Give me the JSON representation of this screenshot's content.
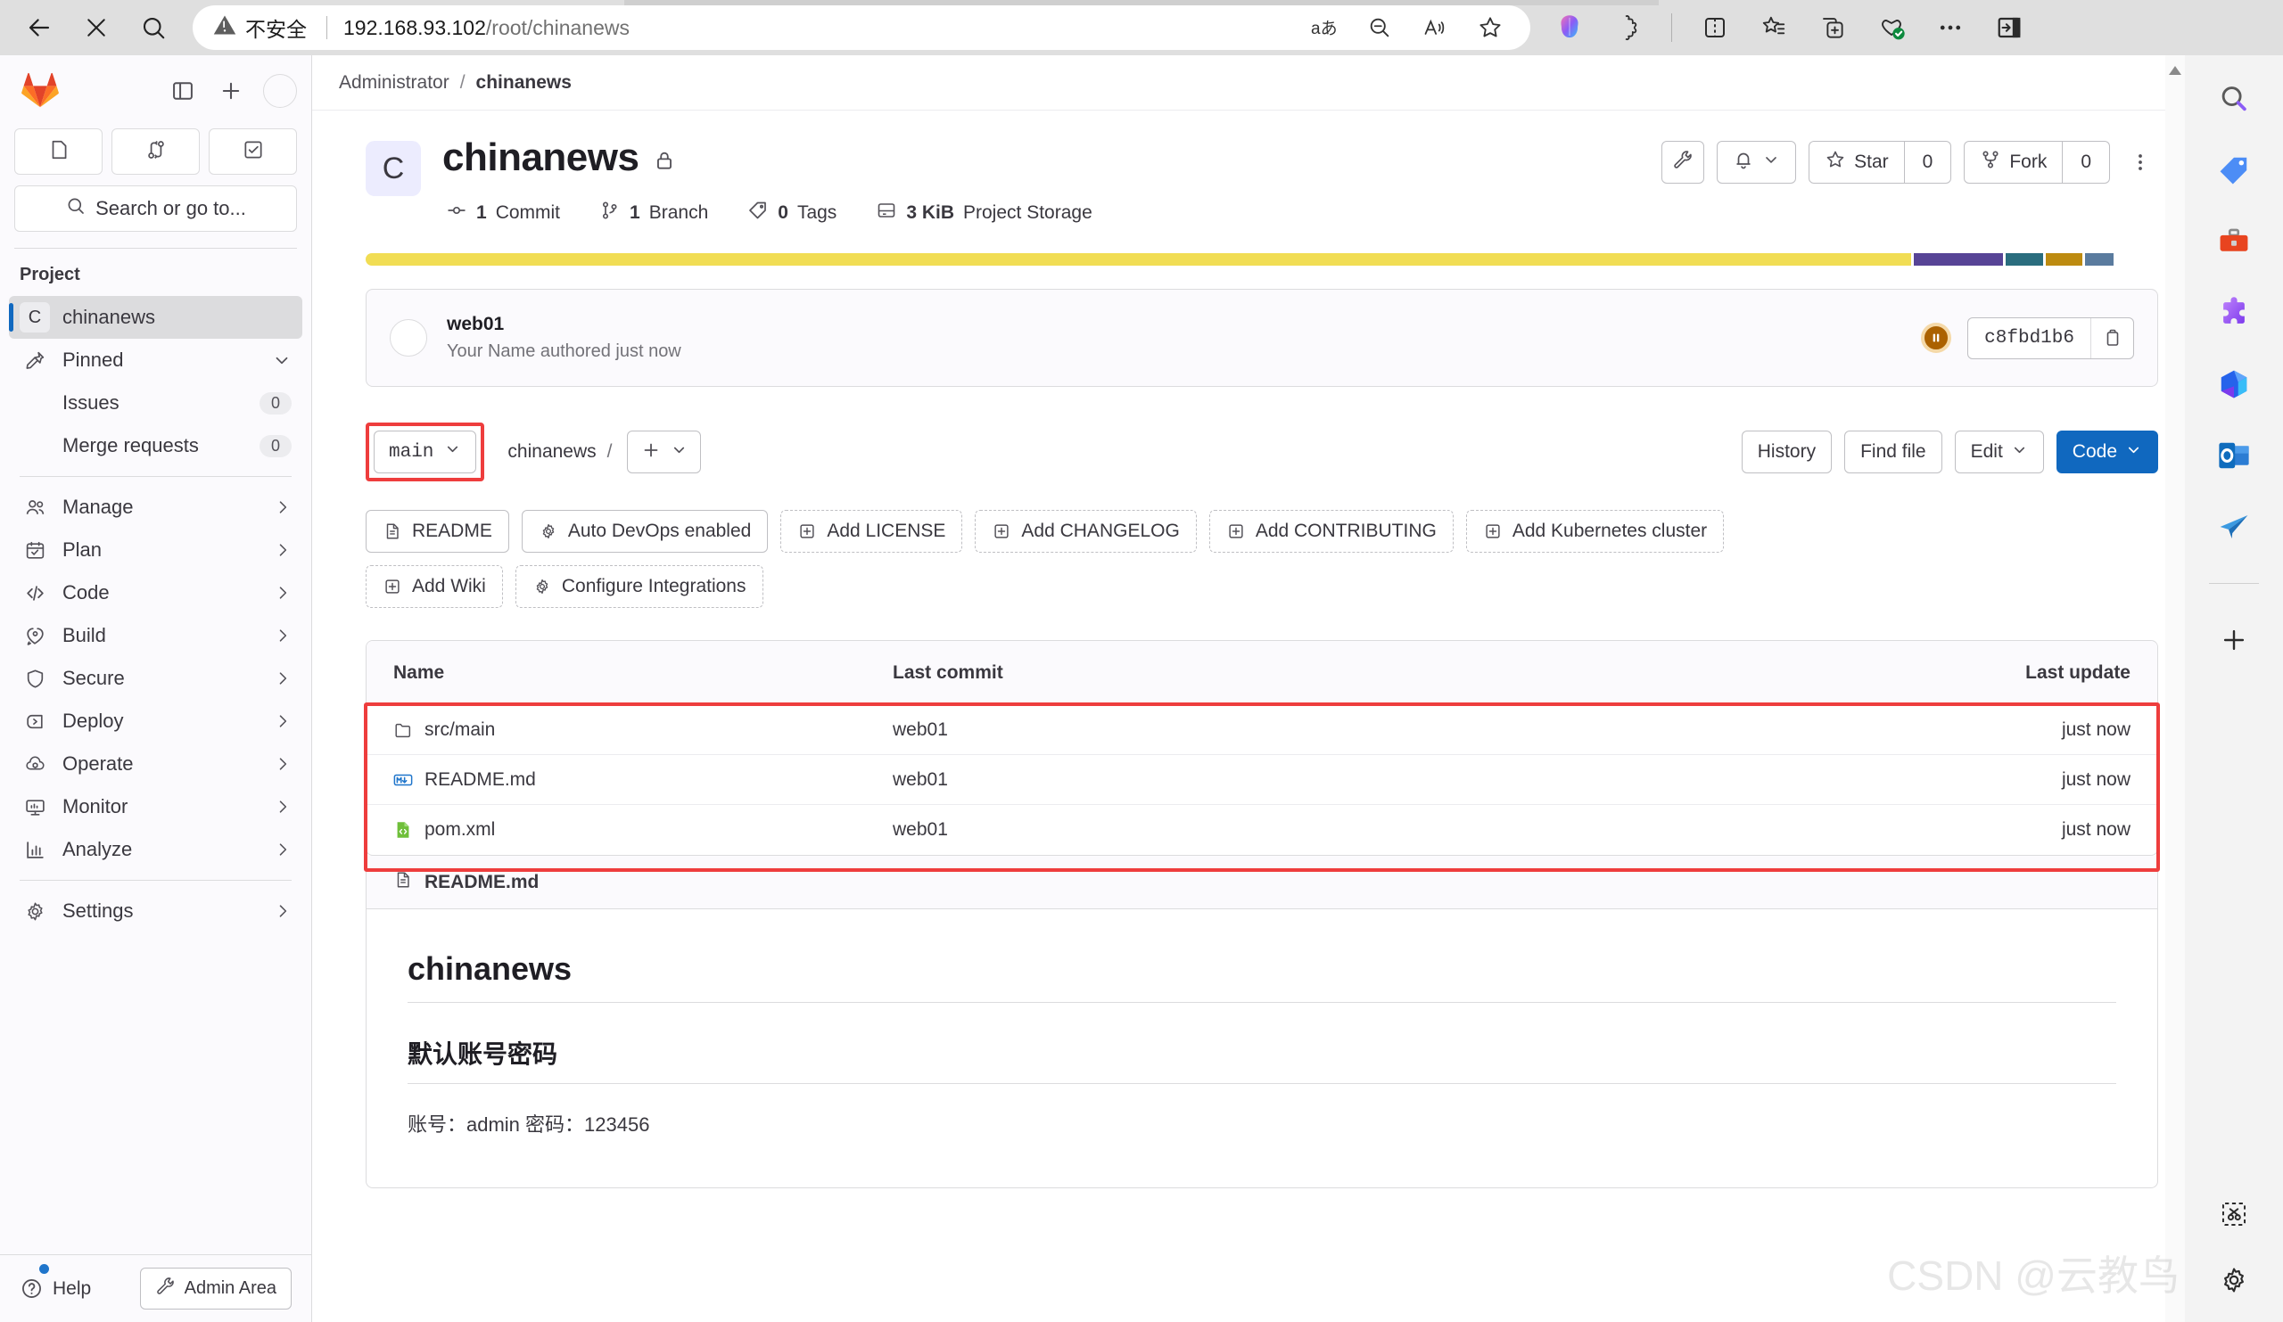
{
  "browser": {
    "security_label": "不安全",
    "url_host": "192.168.93.102",
    "url_path": "/root/chinanews",
    "back_icon": "back-arrow-icon",
    "stop_icon": "stop-x-icon",
    "search_icon": "search-icon",
    "warning_icon": "warning-triangle-icon",
    "url_icons": [
      "translate-icon",
      "zoom-out-icon",
      "read-aloud-icon",
      "favorite-star-icon"
    ],
    "toolbar_icons": [
      "copilot-icon",
      "extensions-icon",
      "split-screen-icon",
      "collections-icon",
      "add-tab-group-icon",
      "browser-essentials-icon",
      "more-options-icon",
      "sidebar-toggle-icon"
    ]
  },
  "sidebar": {
    "logo_icon": "gitlab-logo-icon",
    "toggle_icon": "sidebar-panel-icon",
    "new_icon": "plus-icon",
    "avatar_icon": "user-avatar",
    "quick_buttons": [
      {
        "name": "issues-shortcut",
        "icon": "issue-icon"
      },
      {
        "name": "merge-requests-shortcut",
        "icon": "merge-request-icon"
      },
      {
        "name": "todos-shortcut",
        "icon": "todo-check-icon"
      }
    ],
    "search_placeholder": "Search or go to...",
    "search_icon": "search-icon",
    "section_label": "Project",
    "project": {
      "initial": "C",
      "label": "chinanews"
    },
    "pinned": {
      "label": "Pinned",
      "icon": "pin-icon",
      "chevron": "chevron-down-icon"
    },
    "pinned_items": [
      {
        "label": "Issues",
        "badge": "0"
      },
      {
        "label": "Merge requests",
        "badge": "0"
      }
    ],
    "nav_items": [
      {
        "label": "Manage",
        "icon": "users-icon"
      },
      {
        "label": "Plan",
        "icon": "calendar-icon"
      },
      {
        "label": "Code",
        "icon": "code-brackets-icon"
      },
      {
        "label": "Build",
        "icon": "rocket-icon"
      },
      {
        "label": "Secure",
        "icon": "shield-icon"
      },
      {
        "label": "Deploy",
        "icon": "deploy-icon"
      },
      {
        "label": "Operate",
        "icon": "cloud-gear-icon"
      },
      {
        "label": "Monitor",
        "icon": "monitor-icon"
      },
      {
        "label": "Analyze",
        "icon": "chart-bar-icon"
      }
    ],
    "settings": {
      "label": "Settings",
      "icon": "gear-icon"
    },
    "footer": {
      "help_label": "Help",
      "help_icon": "question-circle-icon",
      "admin_label": "Admin Area",
      "admin_icon": "wrench-icon"
    }
  },
  "breadcrumb": {
    "owner": "Administrator",
    "separator": "/",
    "project": "chinanews"
  },
  "project": {
    "initial": "C",
    "name": "chinanews",
    "visibility_icon": "lock-icon",
    "stats": [
      {
        "icon": "commit-icon",
        "value": "1",
        "label": "Commit"
      },
      {
        "icon": "branch-icon",
        "value": "1",
        "label": "Branch"
      },
      {
        "icon": "tag-icon",
        "value": "0",
        "label": "Tags"
      },
      {
        "icon": "storage-icon",
        "value": "3 KiB",
        "label": "Project Storage"
      }
    ],
    "actions": {
      "wrench_icon": "wrench-icon",
      "notifications_icon": "bell-icon",
      "notifications_chevron": "chevron-down-icon",
      "star_label": "Star",
      "star_icon": "star-icon",
      "star_count": "0",
      "fork_label": "Fork",
      "fork_icon": "fork-icon",
      "fork_count": "0",
      "kebab_icon": "ellipsis-vertical-icon"
    },
    "language_bar": [
      {
        "color": "#f1dd54",
        "width": 86.2
      },
      {
        "color": "#574496",
        "width": 5.0
      },
      {
        "color": "#2a6d7e",
        "width": 2.1
      },
      {
        "color": "#bd8b10",
        "width": 2.0
      },
      {
        "color": "#5a7b9e",
        "width": 1.6
      }
    ]
  },
  "commit": {
    "title": "web01",
    "subtitle": "Your Name authored just now",
    "pipeline_icon": "pipeline-pending-icon",
    "pipeline_color": "#ab6100",
    "sha": "c8fbd1b6",
    "copy_icon": "copy-icon"
  },
  "ref_row": {
    "branch": "main",
    "branch_chevron": "chevron-down-icon",
    "path_project": "chinanews",
    "path_separator": "/",
    "add_icon": "plus-icon",
    "add_chevron": "chevron-down-icon",
    "history_label": "History",
    "find_file_label": "Find file",
    "edit_label": "Edit",
    "edit_chevron": "chevron-down-icon",
    "code_label": "Code",
    "code_chevron": "chevron-down-icon",
    "code_color": "#1068bf"
  },
  "quick_actions": [
    {
      "label": "README",
      "icon": "document-icon",
      "dashed": false
    },
    {
      "label": "Auto DevOps enabled",
      "icon": "gear-circle-icon",
      "dashed": false
    },
    {
      "label": "Add LICENSE",
      "icon": "plus-square-icon",
      "dashed": true
    },
    {
      "label": "Add CHANGELOG",
      "icon": "plus-square-icon",
      "dashed": true
    },
    {
      "label": "Add CONTRIBUTING",
      "icon": "plus-square-icon",
      "dashed": true
    },
    {
      "label": "Add Kubernetes cluster",
      "icon": "plus-square-icon",
      "dashed": true
    },
    {
      "label": "Add Wiki",
      "icon": "plus-square-icon",
      "dashed": true
    },
    {
      "label": "Configure Integrations",
      "icon": "gear-circle-icon",
      "dashed": true
    }
  ],
  "file_table": {
    "columns": [
      "Name",
      "Last commit",
      "Last update"
    ],
    "rows": [
      {
        "name": "src/main",
        "icon": "folder-icon",
        "commit": "web01",
        "update": "just now"
      },
      {
        "name": "README.md",
        "icon": "markdown-icon",
        "commit": "web01",
        "update": "just now"
      },
      {
        "name": "pom.xml",
        "icon": "xml-file-icon",
        "commit": "web01",
        "update": "just now"
      }
    ],
    "highlight_color": "#ee3d3d"
  },
  "readme": {
    "filename": "README.md",
    "file_icon": "document-icon",
    "heading1": "chinanews",
    "heading2": "默认账号密码",
    "paragraph": "账号：admin 密码：123456"
  },
  "watermark": "CSDN @云教鸟",
  "edge_sidebar": {
    "icons": [
      "search-icon",
      "price-tag-icon",
      "tools-icon",
      "puzzle-extension-icon",
      "microsoft-365-icon",
      "outlook-icon",
      "telegram-plane-icon"
    ],
    "add_icon": "plus-icon",
    "bottom_icons": [
      "screenshot-icon",
      "settings-gear-icon"
    ]
  },
  "scrollbar": {
    "up_arrow_icon": "scroll-up-arrow-icon"
  }
}
